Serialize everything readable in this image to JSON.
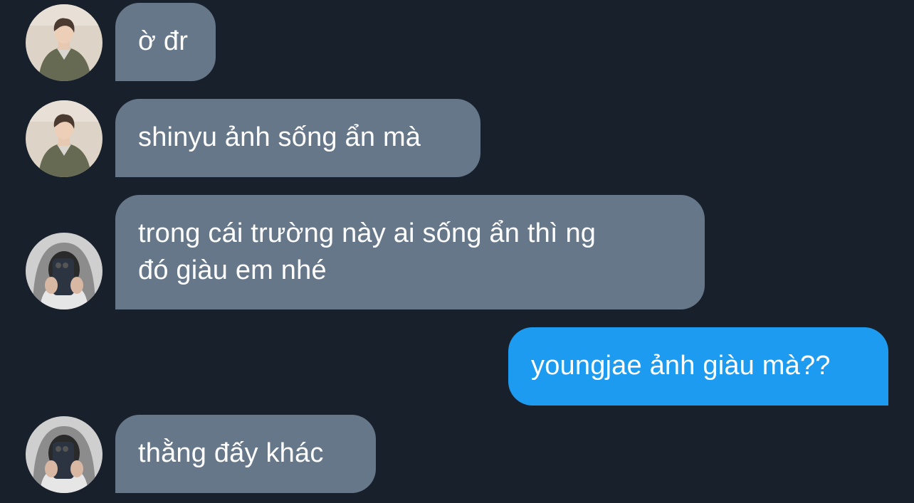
{
  "colors": {
    "background": "#18202b",
    "received_bubble": "#66778a",
    "sent_bubble": "#1d9bf0",
    "text": "#ffffff"
  },
  "messages": [
    {
      "direction": "received",
      "avatar": "avatar-boy-green-jacket",
      "text": "ờ đr"
    },
    {
      "direction": "received",
      "avatar": "avatar-boy-green-jacket",
      "text": "shinyu ảnh sống ẩn mà"
    },
    {
      "direction": "received",
      "avatar": "avatar-mirror-selfie",
      "text": "trong cái trường này ai sống ẩn thì ng\nđó giàu em nhé"
    },
    {
      "direction": "sent",
      "text": "youngjae ảnh giàu mà??"
    },
    {
      "direction": "received",
      "avatar": "avatar-mirror-selfie",
      "text": "thằng đấy khác"
    }
  ]
}
